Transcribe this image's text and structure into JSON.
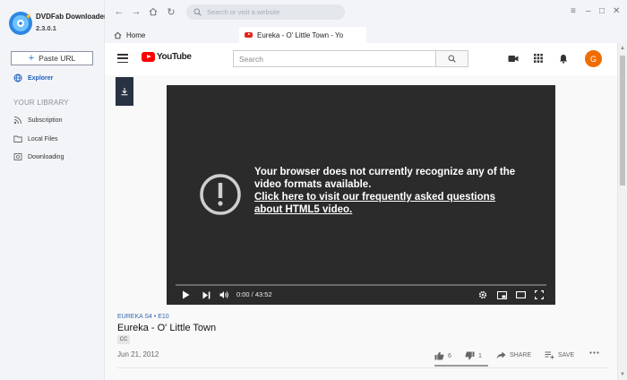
{
  "app": {
    "name": "DVDFab Downloader",
    "version": "2.3.0.1"
  },
  "sidebar": {
    "paste_url_label": "Paste URL",
    "explorer_label": "Explorer",
    "library_title": "YOUR LIBRARY",
    "items": [
      {
        "label": "Subscription",
        "icon": "rss-icon"
      },
      {
        "label": "Local Files",
        "icon": "folder-icon"
      },
      {
        "label": "Downloading",
        "icon": "download-box-icon"
      }
    ]
  },
  "toolbar": {
    "address_placeholder": "Search or visit a website"
  },
  "tabs": [
    {
      "label": "Home",
      "icon": "home-icon"
    },
    {
      "label": "Eureka - O' Little Town - Yo",
      "icon": "youtube-icon"
    }
  ],
  "youtube": {
    "logo_text": "YouTube",
    "search_placeholder": "Search",
    "avatar_letter": "G"
  },
  "player": {
    "error_line1": "Your browser does not currently recognize any of the",
    "error_line2": "video formats available.",
    "error_link1": "Click here to visit our frequently asked questions",
    "error_link2": "about HTML5 video.",
    "time": "0:00 / 43:52"
  },
  "video": {
    "tags": "EUREKA  S4 • E10",
    "title": "Eureka - O' Little Town",
    "cc": "CC",
    "date": "Jun 21, 2012",
    "likes": "6",
    "dislikes": "1",
    "share_label": "SHARE",
    "save_label": "SAVE"
  },
  "colors": {
    "accent": "#1d6fd6",
    "sidebar_bg": "#f2f4f7",
    "player_bg": "#2b2b2b",
    "youtube_red": "#ff0000",
    "avatar": "#ef6c00"
  }
}
